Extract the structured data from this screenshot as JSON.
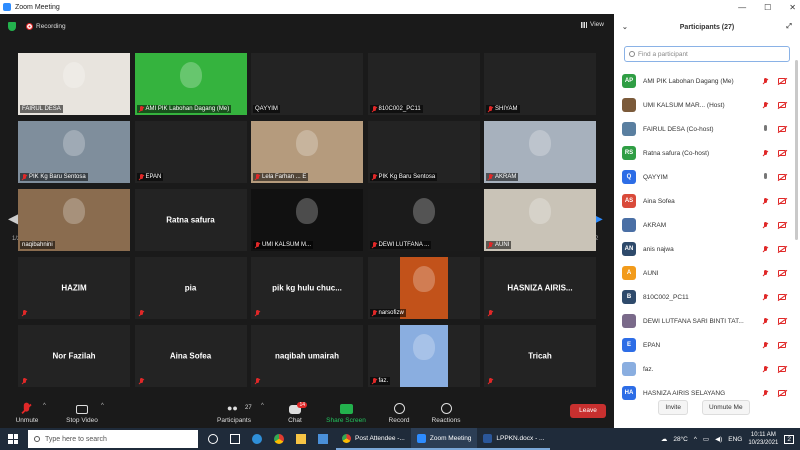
{
  "window": {
    "title": "Zoom Meeting"
  },
  "meeting": {
    "recording_label": "Recording",
    "view_label": "View",
    "page_left": "1/2",
    "page_right": "1/2"
  },
  "tiles": [
    {
      "label": "FAIRUL DESA",
      "type": "video",
      "muted": false,
      "active": true,
      "bg": "#e8e4de"
    },
    {
      "label": "AMI PIK Labohan Dagang (Me)",
      "type": "video",
      "muted": true,
      "bg": "#35b33e"
    },
    {
      "label": "QAYYIM",
      "type": "black",
      "muted": false
    },
    {
      "label": "810C002_PC11",
      "type": "black",
      "muted": true
    },
    {
      "label": "SHIYAM",
      "type": "black",
      "muted": true
    },
    {
      "label": "PIK Kg Baru Sentosa",
      "type": "video",
      "muted": true,
      "bg": "#7f8e9c"
    },
    {
      "label": "EPAN",
      "type": "black",
      "muted": true
    },
    {
      "label": "Lela Farhan ... E",
      "type": "video",
      "muted": true,
      "bg": "#b59b7d"
    },
    {
      "label": "PIK Kg Baru Sentosa",
      "type": "black",
      "muted": true
    },
    {
      "label": "AKRAM",
      "type": "video",
      "muted": true,
      "bg": "#a7b1bd"
    },
    {
      "label": "naqibahnini",
      "type": "video",
      "muted": false,
      "bg": "#8a6c4f"
    },
    {
      "name": "Ratna safura",
      "type": "name"
    },
    {
      "label": "UMI KALSUM M...",
      "type": "video",
      "muted": true,
      "bg": "#111"
    },
    {
      "label": "DEWI LUTFANA ...",
      "type": "video",
      "muted": true,
      "bg": "#1b1b1b"
    },
    {
      "label": "AUNI",
      "type": "video",
      "muted": true,
      "bg": "#c9c3b7"
    },
    {
      "name": "HAZIM",
      "type": "name",
      "muted": true
    },
    {
      "name": "pia",
      "type": "name",
      "muted": true
    },
    {
      "name": "pik kg hulu chuc...",
      "type": "name",
      "muted": true
    },
    {
      "label": "narsofizw",
      "type": "photo",
      "muted": true,
      "bg": "#c2521a"
    },
    {
      "name": "HASNIZA AIRIS...",
      "type": "name",
      "muted": true
    },
    {
      "name": "Nor Fazilah",
      "type": "name",
      "muted": true
    },
    {
      "name": "Aina Sofea",
      "type": "name",
      "muted": true
    },
    {
      "name": "naqibah umairah",
      "type": "name",
      "muted": true
    },
    {
      "label": "faz.",
      "type": "photo",
      "muted": true,
      "bg": "#8aaee0"
    },
    {
      "name": "Tricah",
      "type": "name",
      "muted": true
    }
  ],
  "toolbar": {
    "unmute": "Unmute",
    "stop_video": "Stop Video",
    "participants": "Participants",
    "participants_count": "27",
    "chat": "Chat",
    "chat_badge": "14",
    "share": "Share Screen",
    "record": "Record",
    "reactions": "Reactions",
    "leave": "Leave"
  },
  "panel": {
    "title": "Participants (27)",
    "search_placeholder": "Find a participant",
    "invite": "Invite",
    "unmute_me": "Unmute Me",
    "participants": [
      {
        "initials": "AP",
        "name": "AMI PIK Labohan Dagang (Me)",
        "color": "#2f9e44",
        "mic": "muted",
        "cam": "off"
      },
      {
        "initials": "",
        "name": "UMI KALSUM MAR...",
        "role": "(Host)",
        "color": "#7b5a3a",
        "mic": "muted",
        "cam": "off"
      },
      {
        "initials": "",
        "name": "FAIRUL DESA (Co-host)",
        "color": "#5a7fa0",
        "mic": "on",
        "cam": "off"
      },
      {
        "initials": "RS",
        "name": "Ratna safura (Co-host)",
        "color": "#2f9e44",
        "mic": "muted",
        "cam": "off"
      },
      {
        "initials": "Q",
        "name": "QAYYIM",
        "color": "#2d6de6",
        "mic": "on",
        "cam": "off"
      },
      {
        "initials": "AS",
        "name": "Aina Sofea",
        "color": "#d94a3a",
        "mic": "muted",
        "cam": "off"
      },
      {
        "initials": "",
        "name": "AKRAM",
        "color": "#4a6fa5",
        "mic": "muted",
        "cam": "off"
      },
      {
        "initials": "AN",
        "name": "anis najwa",
        "color": "#2e4a6b",
        "mic": "muted",
        "cam": "off"
      },
      {
        "initials": "A",
        "name": "AUNI",
        "color": "#f29b1b",
        "mic": "muted",
        "cam": "off"
      },
      {
        "initials": "B",
        "name": "810C002_PC11",
        "color": "#2e4a6b",
        "mic": "muted",
        "cam": "off"
      },
      {
        "initials": "",
        "name": "DEWI LUTFANA SARI BINTI TAT...",
        "color": "#7a6a8a",
        "mic": "muted",
        "cam": "off"
      },
      {
        "initials": "E",
        "name": "EPAN",
        "color": "#2d6de6",
        "mic": "muted",
        "cam": "off"
      },
      {
        "initials": "",
        "name": "faz.",
        "color": "#8aaee0",
        "mic": "muted",
        "cam": "off"
      },
      {
        "initials": "HA",
        "name": "HASNIZA AIRIS SELAYANG",
        "color": "#2d6de6",
        "mic": "muted",
        "cam": "off"
      }
    ]
  },
  "taskbar": {
    "search": "Type here to search",
    "apps": [
      "Post Attendee -...",
      "Zoom Meeting",
      "LPPKN.docx - ..."
    ],
    "temp": "28°C",
    "time": "10:11 AM",
    "date": "10/23/2021",
    "notif": "2"
  }
}
